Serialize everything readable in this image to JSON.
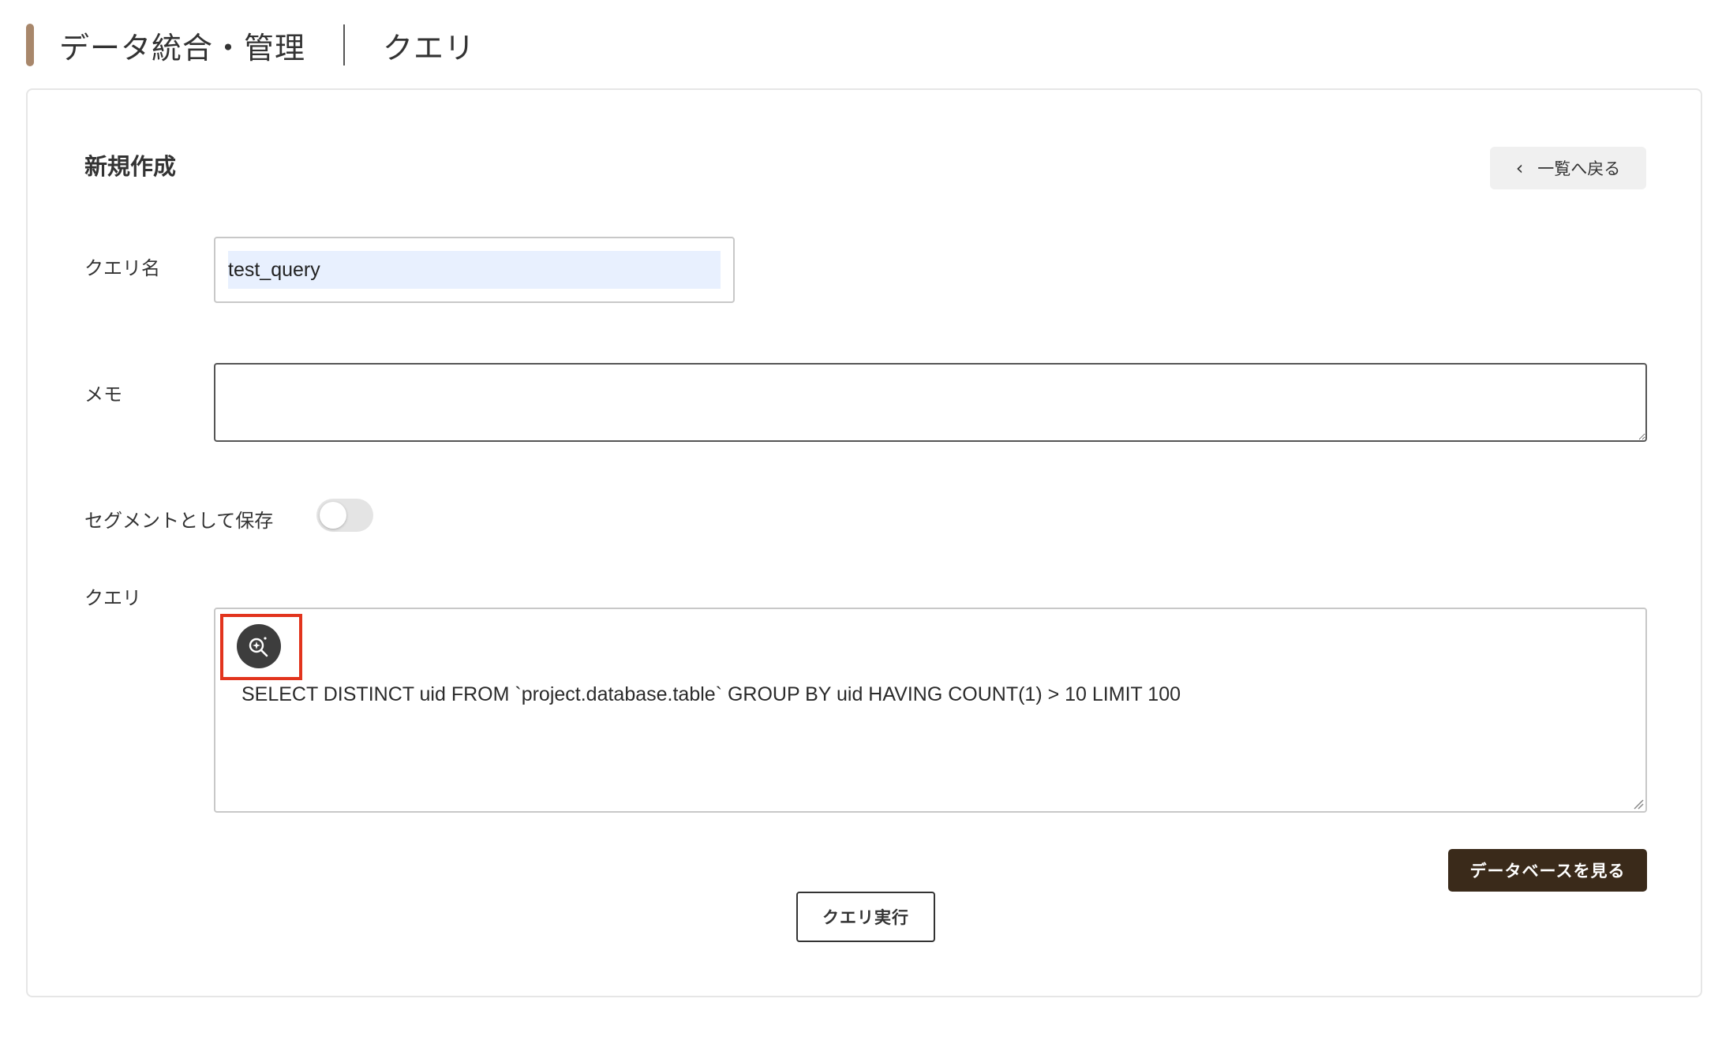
{
  "header": {
    "crumb_primary": "データ統合・管理",
    "crumb_secondary": "クエリ"
  },
  "form": {
    "section_title": "新規作成",
    "back_button_label": "一覧へ戻る",
    "name_label": "クエリ名",
    "name_value": "test_query",
    "memo_label": "メモ",
    "memo_value": "",
    "segment_label": "セグメントとして保存",
    "segment_enabled": false,
    "query_label": "クエリ",
    "query_value": "SELECT DISTINCT uid FROM `project.database.table` GROUP BY uid HAVING COUNT(1) > 10 LIMIT 100",
    "view_database_button": "データベースを見る",
    "run_button": "クエリ実行"
  },
  "icons": {
    "back": "chevron-left-icon",
    "assist": "sparkle-search-icon",
    "resize": "resize-grip-icon"
  },
  "colors": {
    "accent": "#a8876b",
    "primary_button": "#3a2a1a",
    "highlight": "#e2341d",
    "input_autofill": "#e8f0fe"
  }
}
